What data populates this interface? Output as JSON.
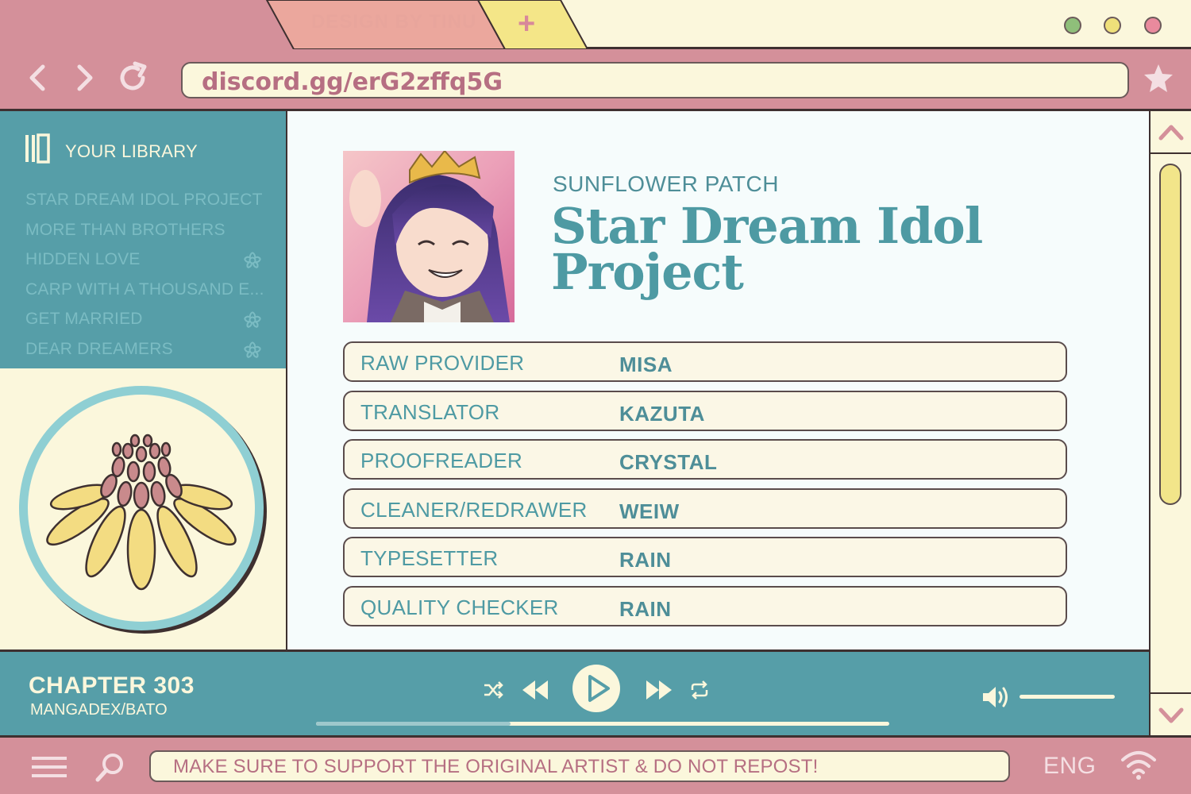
{
  "browser": {
    "tab_title": "DESIGN BY TINU",
    "new_tab_symbol": "+",
    "url": "discord.gg/erG2zffq5G",
    "window_dots": [
      "#8fbf7a",
      "#efe07a",
      "#e98a9d"
    ]
  },
  "sidebar": {
    "header_icon": "library-icon",
    "title": "YOUR LIBRARY",
    "items": [
      {
        "label": "STAR DREAM IDOL PROJECT",
        "flower": false
      },
      {
        "label": "MORE THAN BROTHERS",
        "flower": false
      },
      {
        "label": "HIDDEN LOVE",
        "flower": true
      },
      {
        "label": "CARP WITH A THOUSAND E...",
        "flower": false
      },
      {
        "label": "GET MARRIED",
        "flower": true
      },
      {
        "label": "DEAR DREAMERS",
        "flower": true
      }
    ]
  },
  "main": {
    "group": "SUNFLOWER PATCH",
    "title": "Star Dream Idol Project",
    "credits": [
      {
        "role": "RAW PROVIDER",
        "name": "MISA"
      },
      {
        "role": "TRANSLATOR",
        "name": "KAZUTA"
      },
      {
        "role": "PROOFREADER",
        "name": "CRYSTAL"
      },
      {
        "role": "CLEANER/REDRAWER",
        "name": "WEIW"
      },
      {
        "role": "TYPESETTER",
        "name": "RAIN"
      },
      {
        "role": "QUALITY CHECKER",
        "name": "RAIN"
      }
    ]
  },
  "player": {
    "chapter": "CHAPTER 303",
    "source": "MANGADEX/BATO",
    "progress": 0.34,
    "volume": 1.0
  },
  "taskbar": {
    "notice": "MAKE SURE TO SUPPORT THE ORIGINAL ARTIST & DO NOT REPOST!",
    "language": "ENG"
  },
  "colors": {
    "pink": "#d4909a",
    "teal": "#569ea8",
    "cream": "#fbf7dc",
    "yellow": "#f2e58a"
  }
}
